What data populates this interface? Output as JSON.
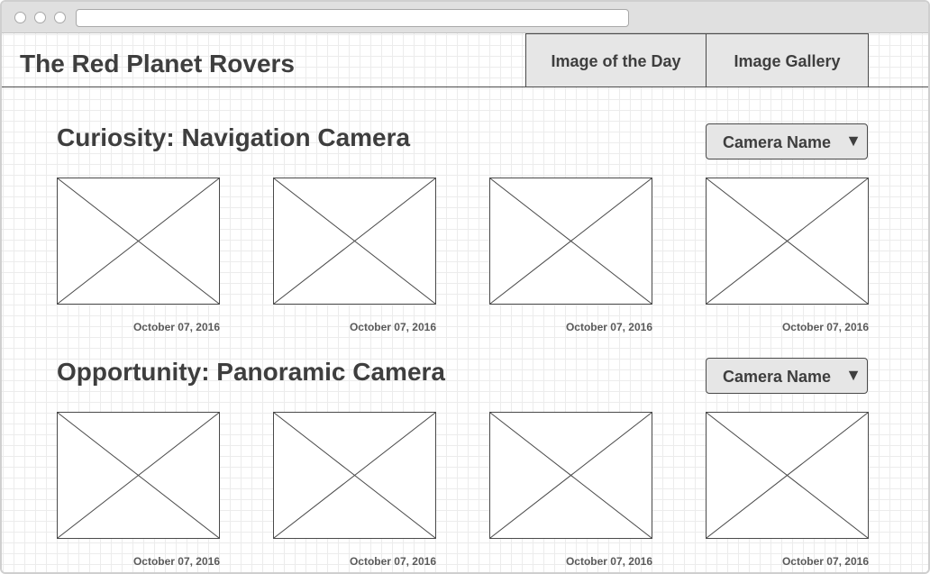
{
  "site": {
    "title": "The Red Planet Rovers"
  },
  "nav": {
    "tabs": [
      {
        "label": "Image of the Day"
      },
      {
        "label": "Image Gallery"
      }
    ]
  },
  "sections": [
    {
      "title": "Curiosity: Navigation Camera",
      "camera_dropdown": {
        "selected": "Camera Name",
        "arrow": "▼"
      },
      "images": [
        {
          "date": "October 07, 2016"
        },
        {
          "date": "October 07, 2016"
        },
        {
          "date": "October 07, 2016"
        },
        {
          "date": "October 07, 2016"
        }
      ]
    },
    {
      "title": "Opportunity: Panoramic Camera",
      "camera_dropdown": {
        "selected": "Camera Name",
        "arrow": "▼"
      },
      "images": [
        {
          "date": "October 07, 2016"
        },
        {
          "date": "October 07, 2016"
        },
        {
          "date": "October 07, 2016"
        },
        {
          "date": "October 07, 2016"
        }
      ]
    }
  ],
  "icons": {
    "image_placeholder": "image-placeholder-icon",
    "dropdown_arrow": "chevron-down-icon"
  },
  "colors": {
    "text": "#3e3e3e",
    "tab_background": "#e6e6e6",
    "border": "#4a4a4a",
    "grid": "#ececec"
  }
}
